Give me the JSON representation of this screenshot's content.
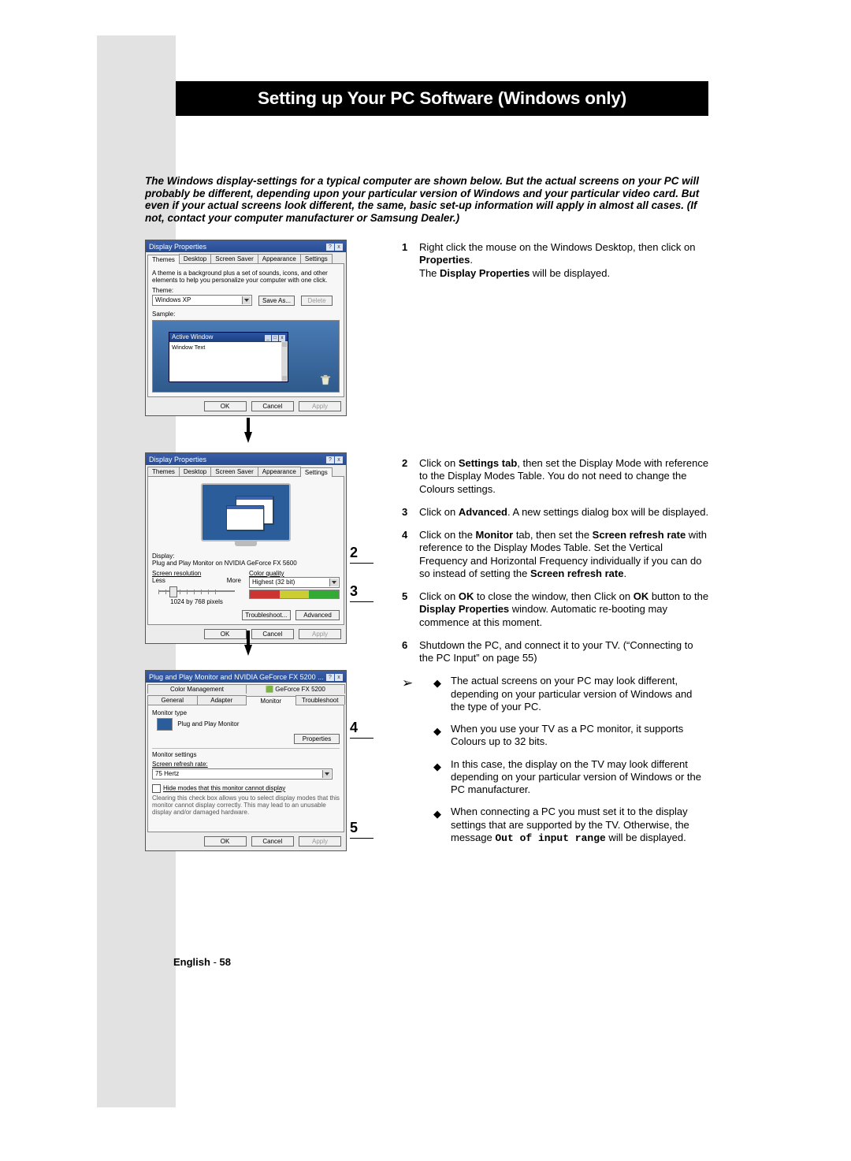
{
  "page_title": "Setting up Your PC Software (Windows only)",
  "intro_text": "The Windows display-settings for a typical computer are shown below. But the actual screens on your PC will probably be different, depending upon your particular version of Windows and your particular video card. But even if your actual screens look different, the same, basic set-up information will apply in almost all cases. (If not, contact your computer manufacturer or Samsung Dealer.)",
  "dialog1": {
    "title": "Display Properties",
    "tabs": [
      "Themes",
      "Desktop",
      "Screen Saver",
      "Appearance",
      "Settings"
    ],
    "active_tab": 0,
    "description": "A theme is a background plus a set of sounds, icons, and other elements to help you personalize your computer with one click.",
    "theme_label": "Theme:",
    "theme_value": "Windows XP",
    "save_as": "Save As...",
    "delete": "Delete",
    "sample_label": "Sample:",
    "active_window": "Active Window",
    "window_text": "Window Text",
    "buttons": {
      "ok": "OK",
      "cancel": "Cancel",
      "apply": "Apply"
    }
  },
  "dialog2": {
    "title": "Display Properties",
    "tabs": [
      "Themes",
      "Desktop",
      "Screen Saver",
      "Appearance",
      "Settings"
    ],
    "active_tab": 4,
    "display_label": "Display:",
    "display_value": "Plug and Play Monitor on NVIDIA GeForce FX 5600",
    "res_label": "Screen resolution",
    "res_less": "Less",
    "res_more": "More",
    "res_value": "1024 by 768 pixels",
    "quality_label": "Color quality",
    "quality_value": "Highest (32 bit)",
    "troubleshoot": "Troubleshoot...",
    "advanced": "Advanced",
    "buttons": {
      "ok": "OK",
      "cancel": "Cancel",
      "apply": "Apply"
    }
  },
  "dialog3": {
    "title": "Plug and Play Monitor and NVIDIA GeForce FX 5200 ...",
    "tabs_row1": [
      "Color Management",
      "GeForce FX 5200"
    ],
    "tabs_row2": [
      "General",
      "Adapter",
      "Monitor",
      "Troubleshoot"
    ],
    "active_tab_row2": 2,
    "monitor_type_label": "Monitor type",
    "monitor_type_value": "Plug and Play Monitor",
    "properties": "Properties",
    "monitor_settings_label": "Monitor settings",
    "refresh_label": "Screen refresh rate:",
    "refresh_value": "75 Hertz",
    "hide_modes": "Hide modes that this monitor cannot display",
    "hide_modes_help": "Clearing this check box allows you to select display modes that this monitor cannot display correctly. This may lead to an unusable display and/or damaged hardware.",
    "buttons": {
      "ok": "OK",
      "cancel": "Cancel",
      "apply": "Apply"
    }
  },
  "callouts": {
    "two": "2",
    "three": "3",
    "four": "4",
    "five": "5"
  },
  "steps": {
    "s1_num": "1",
    "s1a": "Right click the mouse on the Windows Desktop, then click on ",
    "s1b": "Properties",
    "s1c": ".",
    "s1d": "The ",
    "s1e": "Display Properties",
    "s1f": " will be displayed.",
    "s2_num": "2",
    "s2a": "Click on ",
    "s2b": "Settings tab",
    "s2c": ", then set the Display Mode with reference to the Display Modes Table. You do not need to change the Colours settings.",
    "s3_num": "3",
    "s3a": "Click on ",
    "s3b": "Advanced",
    "s3c": ". A new settings dialog box will be displayed.",
    "s4_num": "4",
    "s4a": "Click on the ",
    "s4b": "Monitor",
    "s4c": " tab, then set the ",
    "s4d": "Screen refresh rate",
    "s4e": " with reference to the Display Modes Table. Set the Vertical Frequency and Horizontal Frequency individually if you can do so instead of setting the ",
    "s4f": "Screen refresh rate",
    "s4g": ".",
    "s5_num": "5",
    "s5a": "Click on ",
    "s5b": "OK",
    "s5c": " to close the window, then Click on ",
    "s5d": "OK",
    "s5e": " button to the ",
    "s5f": "Display Properties",
    "s5g": " window. Automatic re-booting may commence at this moment.",
    "s6_num": "6",
    "s6a": "Shutdown the PC, and connect it to your TV. (“Connecting to the PC Input” on page 55)"
  },
  "notes": {
    "n1": "The actual screens on your PC may look different, depending on your particular version of Windows and the type of your PC.",
    "n2": "When you use your TV as a PC monitor, it supports Colours up to 32 bits.",
    "n3": "In this case, the display on the TV may look different depending on your particular version of Windows or the PC manufacturer.",
    "n4a": "When connecting a PC you must set it to the display settings that are supported by the TV. Otherwise, the message ",
    "n4b": "Out of input range",
    "n4c": " will be displayed."
  },
  "footer": {
    "lang": "English",
    "sep": " - ",
    "page": "58"
  }
}
